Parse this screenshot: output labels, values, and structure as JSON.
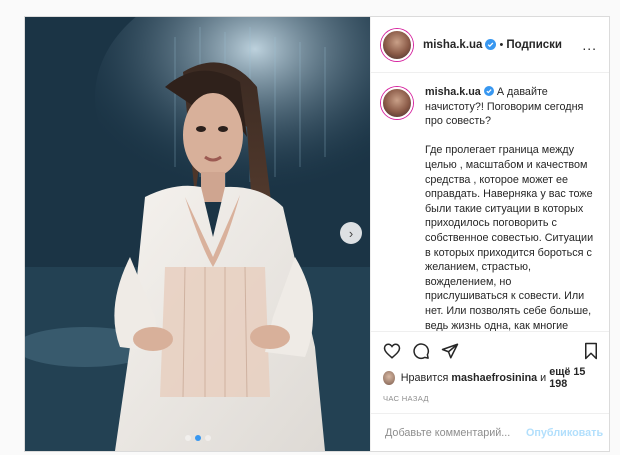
{
  "header": {
    "username": "misha.k.ua",
    "separator": "•",
    "follow_label": "Подписки",
    "more_label": "..."
  },
  "caption": {
    "username": "misha.k.ua",
    "text": "А давайте начистоту?! Поговорим сегодня про совесть?\n\nГде пролегает граница между целью , масштабом и качеством средства , которое может ее оправдать. Наверняка у вас тоже были такие ситуации в которых приходилось поговорить с собственное совестью. Ситуации в которых приходится бороться с желанием, страстью, вожделением, но прислушиваться к совести. Или нет. Или позволять себе больше, ведь жизнь одна, как многие говорят.\n\nКак в моменте, когда эмоции захватывают все сознание, застилают глаза, делать правильный"
  },
  "likes": {
    "prefix": "Нравится",
    "user": "mashaefrosinina",
    "middle": "и",
    "count": "ещё 15 198"
  },
  "time_label": "час назад",
  "comment": {
    "placeholder": "Добавьте комментарий...",
    "publish_label": "Опубликовать"
  },
  "carousel": {
    "next_glyph": "›",
    "slide_count": 3,
    "active_index": 1
  },
  "icons": [
    "verified-badge-icon",
    "heart-icon",
    "comment-icon",
    "share-icon",
    "bookmark-icon",
    "more-icon",
    "carousel-next-icon"
  ],
  "colors": {
    "verified": "#3897f0",
    "publish_disabled": "#b2dffc",
    "border": "#dbdbdb"
  }
}
